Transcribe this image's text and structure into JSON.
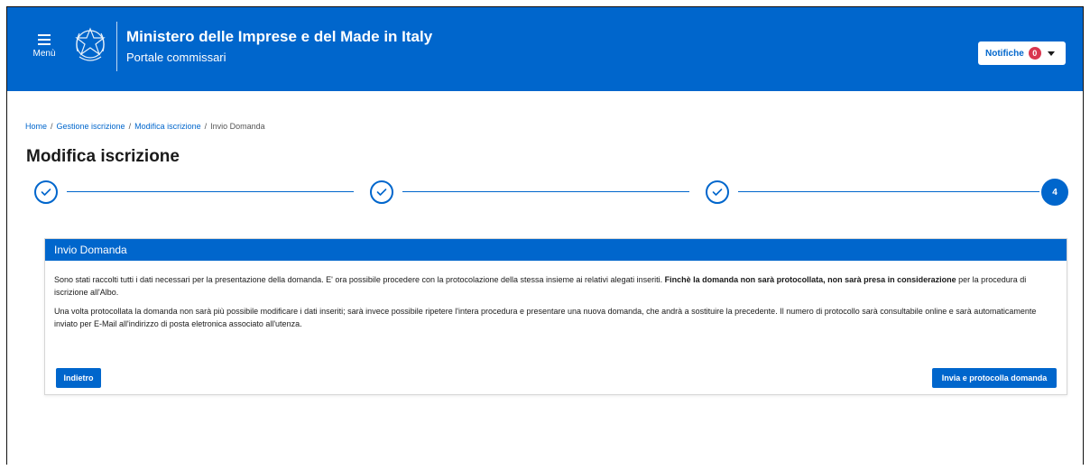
{
  "header": {
    "menu_label": "Menù",
    "title": "Ministero delle Imprese e del Made in Italy",
    "subtitle": "Portale commissari",
    "notifications_label": "Notifiche",
    "notifications_count": "0",
    "brand_color": "#0066cc"
  },
  "breadcrumb": {
    "items": [
      "Home",
      "Gestione iscrizione",
      "Modifica iscrizione"
    ],
    "current": "Invio Domanda"
  },
  "page": {
    "title": "Modifica iscrizione"
  },
  "stepper": {
    "steps": [
      {
        "state": "completed",
        "icon": "check-icon"
      },
      {
        "state": "completed",
        "icon": "check-icon"
      },
      {
        "state": "completed",
        "icon": "check-icon"
      },
      {
        "state": "active",
        "label": "4"
      }
    ]
  },
  "card": {
    "title": "Invio Domanda",
    "paragraph1_pre": "Sono stati raccolti tutti i dati necessari per la presentazione della domanda. E' ora possibile procedere con la protocolazione della stessa insieme ai relativi alegati inseriti. ",
    "paragraph1_bold": "Finchè la domanda non sarà protocollata, non sarà presa in considerazione",
    "paragraph1_post": " per la procedura di iscrizione all'Albo.",
    "paragraph2": "Una volta protocollata la domanda non sarà più possibile modificare i dati inseriti; sarà invece possibile ripetere l'intera procedura e presentare una nuova domanda, che andrà a sostituire la precedente. Il numero di protocollo sarà consultabile online e sarà automaticamente inviato per E-Mail all'indirizzo di posta eletronica associato all'utenza.",
    "back_label": "Indietro",
    "submit_label": "Invia e protocolla domanda"
  }
}
